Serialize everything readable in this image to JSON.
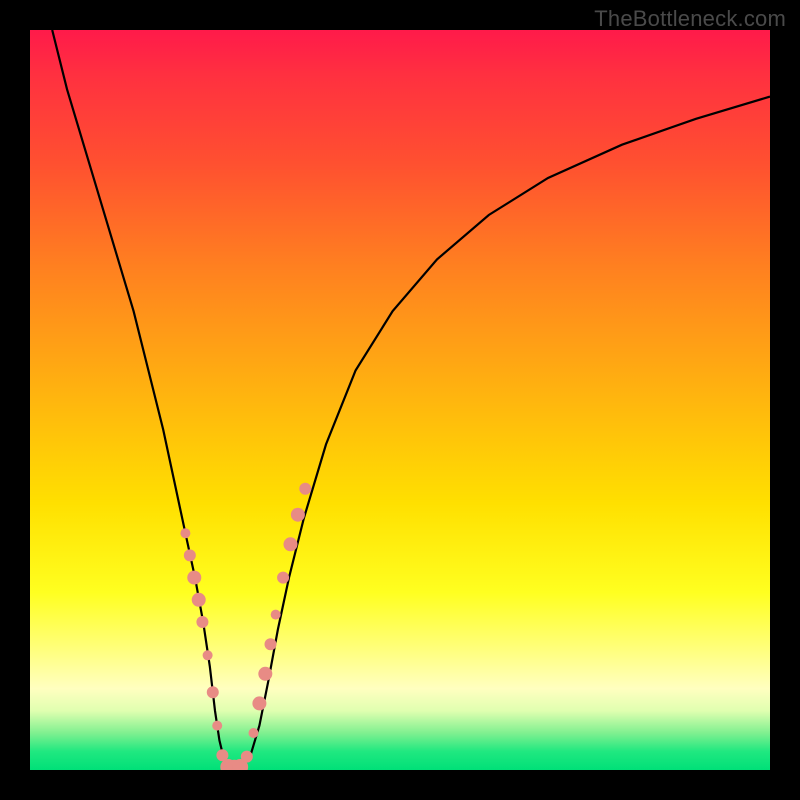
{
  "watermark": "TheBottleneck.com",
  "colors": {
    "frame": "#000000",
    "curve": "#000000",
    "marker": "#e88b85"
  },
  "chart_data": {
    "type": "line",
    "title": "",
    "xlabel": "",
    "ylabel": "",
    "xlim": [
      0,
      100
    ],
    "ylim": [
      0,
      100
    ],
    "grid": false,
    "legend": false,
    "series": [
      {
        "name": "bottleneck-curve",
        "x": [
          3,
          5,
          8,
          11,
          14,
          16,
          18,
          19.5,
          21,
          22.3,
          23.4,
          24.3,
          25.0,
          25.6,
          26.2,
          27.2,
          28.5,
          29.8,
          31.0,
          32.2,
          33.5,
          35.0,
          37.0,
          40.0,
          44.0,
          49.0,
          55.0,
          62.0,
          70.0,
          80.0,
          90.0,
          100.0
        ],
        "y": [
          100,
          92,
          82,
          72,
          62,
          54,
          46,
          39,
          32,
          26,
          20,
          14,
          8,
          4,
          1.5,
          0.3,
          0.3,
          2,
          6,
          12,
          19,
          26,
          34,
          44,
          54,
          62,
          69,
          75,
          80,
          84.5,
          88,
          91
        ]
      }
    ],
    "markers": {
      "name": "highlight-markers",
      "shape": "circle",
      "radius_range": [
        4,
        9
      ],
      "points": [
        {
          "x": 21.0,
          "y": 32.0,
          "r": 5
        },
        {
          "x": 21.6,
          "y": 29.0,
          "r": 6
        },
        {
          "x": 22.2,
          "y": 26.0,
          "r": 7
        },
        {
          "x": 22.8,
          "y": 23.0,
          "r": 7
        },
        {
          "x": 23.3,
          "y": 20.0,
          "r": 6
        },
        {
          "x": 24.0,
          "y": 15.5,
          "r": 5
        },
        {
          "x": 24.7,
          "y": 10.5,
          "r": 6
        },
        {
          "x": 25.3,
          "y": 6.0,
          "r": 5
        },
        {
          "x": 26.0,
          "y": 2.0,
          "r": 6
        },
        {
          "x": 26.8,
          "y": 0.4,
          "r": 8
        },
        {
          "x": 27.6,
          "y": 0.3,
          "r": 8
        },
        {
          "x": 28.4,
          "y": 0.4,
          "r": 8
        },
        {
          "x": 29.3,
          "y": 1.8,
          "r": 6
        },
        {
          "x": 30.2,
          "y": 5.0,
          "r": 5
        },
        {
          "x": 31.0,
          "y": 9.0,
          "r": 7
        },
        {
          "x": 31.8,
          "y": 13.0,
          "r": 7
        },
        {
          "x": 32.5,
          "y": 17.0,
          "r": 6
        },
        {
          "x": 33.2,
          "y": 21.0,
          "r": 5
        },
        {
          "x": 34.2,
          "y": 26.0,
          "r": 6
        },
        {
          "x": 35.2,
          "y": 30.5,
          "r": 7
        },
        {
          "x": 36.2,
          "y": 34.5,
          "r": 7
        },
        {
          "x": 37.2,
          "y": 38.0,
          "r": 6
        }
      ]
    }
  }
}
